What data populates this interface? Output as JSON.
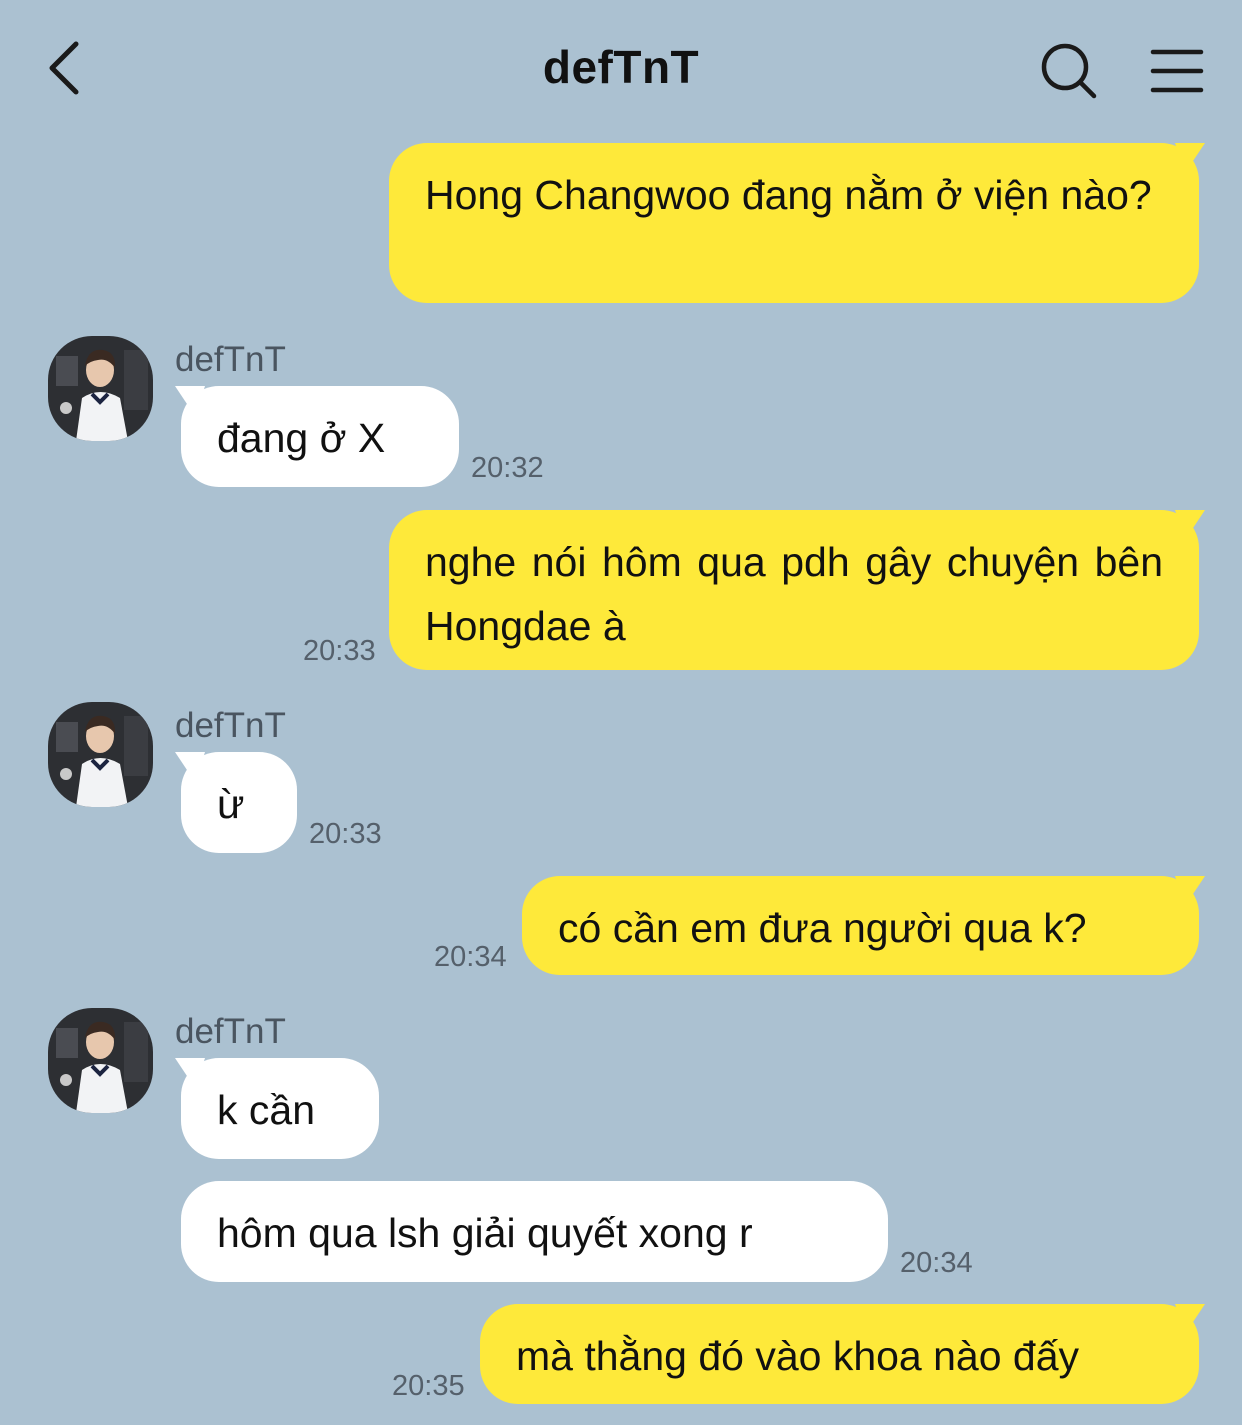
{
  "header": {
    "title": "defTnT",
    "back_icon": "chevron-left-icon",
    "search_icon": "search-icon",
    "menu_icon": "hamburger-menu-icon"
  },
  "colors": {
    "background": "#abc1d1",
    "my_bubble": "#fee93a",
    "their_bubble": "#ffffff"
  },
  "messages": [
    {
      "from": "me",
      "text": "Hong Changwoo đang nằm ở viện nào?",
      "time": ""
    },
    {
      "from": "defTnT",
      "sender": "defTnT",
      "text": "đang ở X",
      "time": "20:32"
    },
    {
      "from": "me",
      "text": "nghe nói hôm qua pdh gây chuyện bên Hongdae à",
      "time": "20:33"
    },
    {
      "from": "defTnT",
      "sender": "defTnT",
      "text": "ừ",
      "time": "20:33"
    },
    {
      "from": "me",
      "text": "có cần em đưa người qua k?",
      "time": "20:34"
    },
    {
      "from": "defTnT",
      "sender": "defTnT",
      "text": "k cần",
      "time": ""
    },
    {
      "from": "defTnT",
      "text": "hôm qua lsh giải quyết xong r",
      "time": "20:34"
    },
    {
      "from": "me",
      "text": "mà thằng đó vào khoa nào đấy",
      "time": "20:35"
    }
  ]
}
